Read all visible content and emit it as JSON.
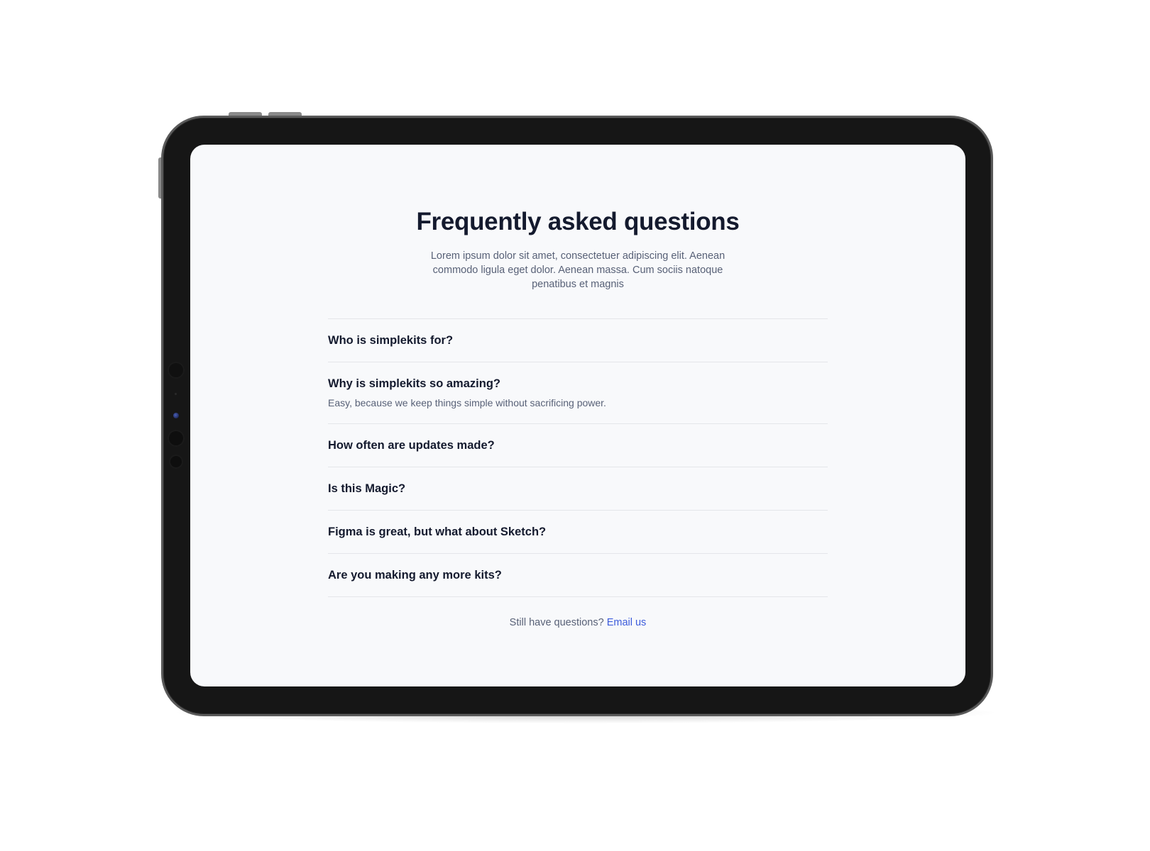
{
  "page": {
    "title": "Frequently asked questions",
    "subtitle": "Lorem ipsum dolor sit amet, consectetuer adipiscing elit. Aenean commodo ligula eget dolor. Aenean massa. Cum sociis natoque penatibus et magnis"
  },
  "faq": [
    {
      "question": "Who is simplekits for?",
      "answer": ""
    },
    {
      "question": "Why is simplekits so amazing?",
      "answer": "Easy, because we keep things simple without sacrificing power."
    },
    {
      "question": "How often are updates made?",
      "answer": ""
    },
    {
      "question": "Is this Magic?",
      "answer": ""
    },
    {
      "question": "Figma is great, but what about Sketch?",
      "answer": ""
    },
    {
      "question": "Are you making any more kits?",
      "answer": ""
    }
  ],
  "footer": {
    "prompt": "Still have questions?",
    "link_label": "Email us"
  },
  "colors": {
    "heading": "#141a2e",
    "body": "#586177",
    "link": "#3b5bdb",
    "screen_bg": "#f8f9fb",
    "divider": "#e4e6ea"
  }
}
